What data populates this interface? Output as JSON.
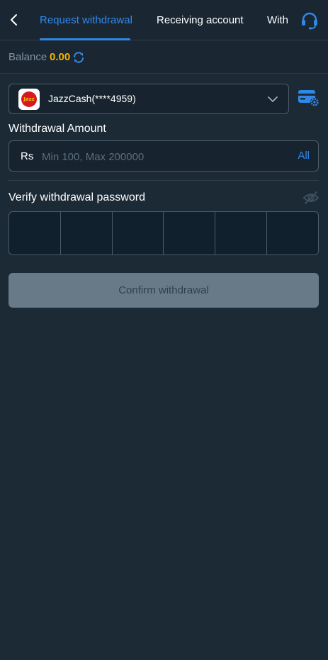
{
  "header": {
    "back_icon": "chevron-left-icon",
    "tabs": [
      {
        "label": "Request withdrawal",
        "active": true
      },
      {
        "label": "Receiving account",
        "active": false
      },
      {
        "label": "With",
        "active": false
      }
    ],
    "support_icon": "headset-icon"
  },
  "balance": {
    "label": "Balance",
    "value": "0.00",
    "refresh_icon": "refresh-icon"
  },
  "account": {
    "logo_text": "Jazz",
    "label": "JazzCash(****4959)",
    "dropdown_icon": "chevron-down-icon",
    "manage_icon": "card-settings-icon"
  },
  "amount": {
    "section_label": "Withdrawal Amount",
    "currency": "Rs",
    "placeholder": "Min 100, Max 200000",
    "value": "",
    "all_label": "All"
  },
  "password": {
    "section_label": "Verify withdrawal password",
    "visibility_icon": "eye-off-icon",
    "digits": [
      "",
      "",
      "",
      "",
      "",
      ""
    ]
  },
  "confirm_label": "Confirm withdrawal",
  "colors": {
    "accent": "#2f88e8",
    "balance": "#f5b400",
    "background": "#1c2a36",
    "button_disabled": "#687a88"
  }
}
